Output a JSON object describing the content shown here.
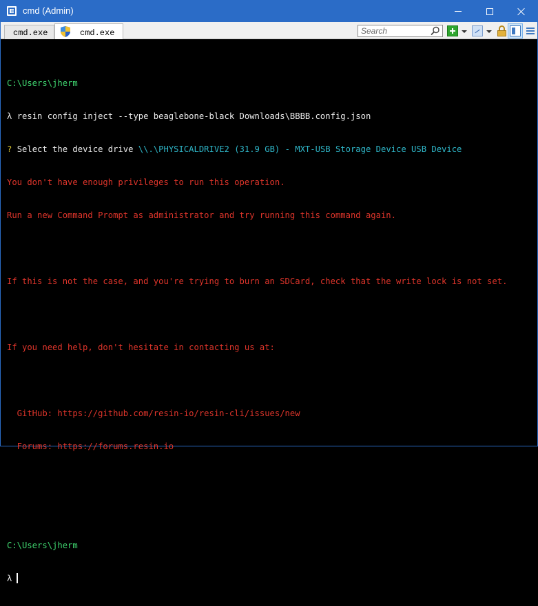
{
  "window": {
    "title": "cmd (Admin)"
  },
  "tabs": [
    {
      "label": "cmd.exe"
    },
    {
      "label": "cmd.exe"
    }
  ],
  "search": {
    "placeholder": "Search"
  },
  "colors": {
    "titlebar": "#2b6cc7",
    "prompt_green": "#3fd56f",
    "error_red": "#e0352b",
    "device_cyan": "#2fb7c9",
    "question_yellow": "#d9c42f"
  },
  "console": {
    "prompt1": "C:\\Users\\jherm",
    "cmd_prefix": "λ ",
    "command": "resin config inject --type beaglebone-black Downloads\\BBBB.config.json",
    "question_mark": "? ",
    "select_label": "Select the device drive ",
    "device": "\\\\.\\PHYSICALDRIVE2 (31.9 GB) - MXT-USB Storage Device USB Device",
    "err1": "You don't have enough privileges to run this operation.",
    "err2": "Run a new Command Prompt as administrator and try running this command again.",
    "err3": "If this is not the case, and you're trying to burn an SDCard, check that the write lock is not set.",
    "err4": "If you need help, don't hesitate in contacting us at:",
    "github": "  GitHub: https://github.com/resin-io/resin-cli/issues/new",
    "forums": "  Forums: https://forums.resin.io",
    "prompt2": "C:\\Users\\jherm",
    "cmd_prefix2": "λ"
  }
}
